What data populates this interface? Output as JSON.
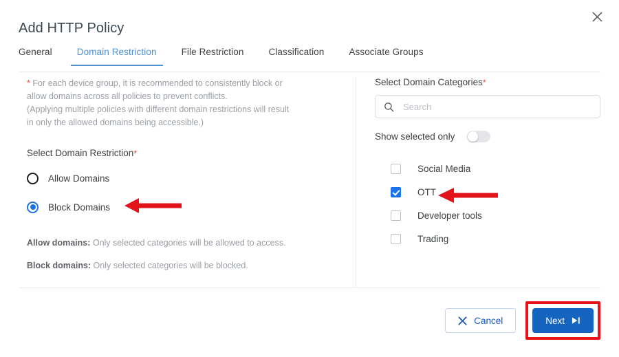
{
  "dialog": {
    "title": "Add HTTP Policy",
    "close_icon": "close-icon"
  },
  "tabs": [
    {
      "label": "General",
      "active": false
    },
    {
      "label": "Domain Restriction",
      "active": true
    },
    {
      "label": "File Restriction",
      "active": false
    },
    {
      "label": "Classification",
      "active": false
    },
    {
      "label": "Associate Groups",
      "active": false
    }
  ],
  "left_panel": {
    "notice_marker": "*",
    "notice_line1": "For each device group, it is recommended to consistently block or",
    "notice_line2": "allow domains across all policies to prevent conflicts.",
    "notice_line3": "(Applying multiple policies with different domain restrictions will result",
    "notice_line4": "in only the allowed domains being accessible.)",
    "restriction_label": "Select Domain Restriction",
    "required_marker": "*",
    "radios": [
      {
        "label": "Allow Domains",
        "selected": false
      },
      {
        "label": "Block Domains",
        "selected": true
      }
    ],
    "hint_allow_title": "Allow domains:",
    "hint_allow_text": " Only selected categories will be allowed to access.",
    "hint_block_title": "Block domains:",
    "hint_block_text": " Only selected categories will be blocked."
  },
  "right_panel": {
    "categories_label": "Select Domain Categories",
    "required_marker": "*",
    "search": {
      "placeholder": "Search",
      "value": "",
      "icon": "search-icon"
    },
    "toggle": {
      "label": "Show selected only",
      "state": "off"
    },
    "categories": [
      {
        "label": "Social Media",
        "checked": false
      },
      {
        "label": "OTT",
        "checked": true
      },
      {
        "label": "Developer tools",
        "checked": false
      },
      {
        "label": "Trading",
        "checked": false
      }
    ]
  },
  "footer": {
    "cancel_label": "Cancel",
    "cancel_icon": "x-icon",
    "next_label": "Next",
    "next_icon": "skip-forward-icon"
  },
  "annotations": {
    "arrow_block_domains": "red-arrow-pointing-left",
    "arrow_ott": "red-arrow-pointing-left",
    "highlight_next": "red-rectangle-highlight"
  },
  "colors": {
    "accent_blue": "#1a73e8",
    "tab_active": "#4d8fd0",
    "primary_button": "#1565c0",
    "required_red": "#ea4335",
    "annotation_red": "#e8131a",
    "muted_text": "#9aa0a6"
  }
}
